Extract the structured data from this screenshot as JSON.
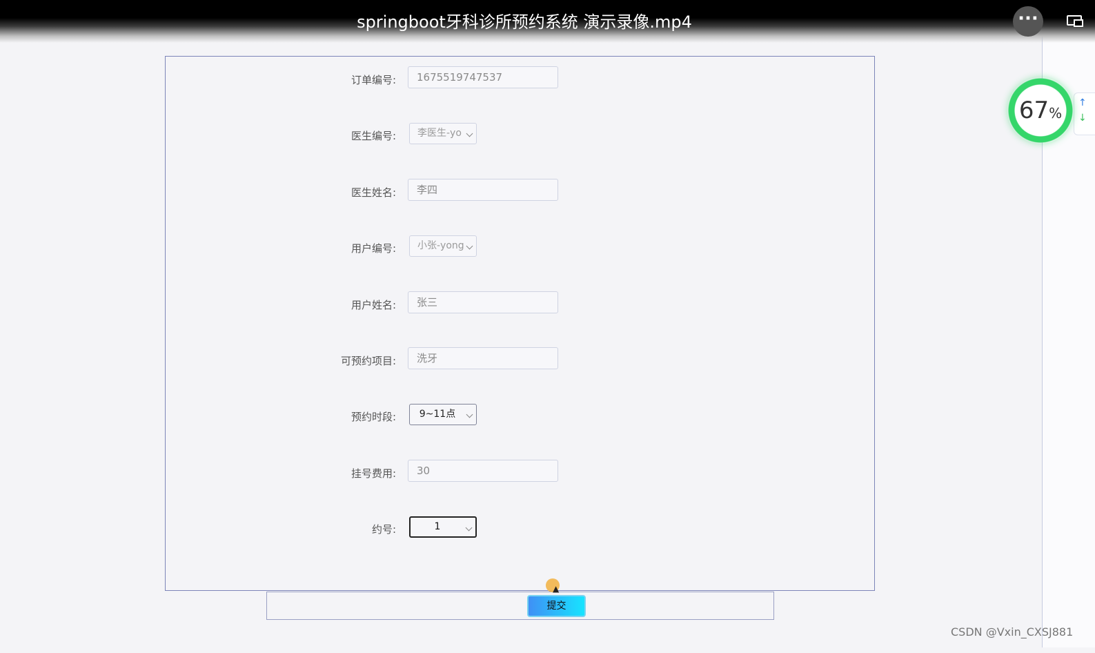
{
  "video": {
    "title": "springboot牙科诊所预约系统 演示录像.mp4",
    "more_label": "···"
  },
  "badge": {
    "value": "67",
    "unit": "%"
  },
  "form": {
    "order_no": {
      "label": "订单编号:",
      "value": "1675519747537"
    },
    "doctor_id": {
      "label": "医生编号:",
      "value": "李医生-yo"
    },
    "doctor_name": {
      "label": "医生姓名:",
      "value": "李四"
    },
    "user_id": {
      "label": "用户编号:",
      "value": "小张-yong"
    },
    "user_name": {
      "label": "用户姓名:",
      "value": "张三"
    },
    "project": {
      "label": "可预约项目:",
      "value": "洗牙"
    },
    "time_slot": {
      "label": "预约时段:",
      "value": "9~11点"
    },
    "fee": {
      "label": "挂号费用:",
      "value": "30"
    },
    "appointment_no": {
      "label": "约号:",
      "value": "1"
    }
  },
  "submit_label": "提交",
  "watermark": "CSDN @Vxin_CXSJ881",
  "icons": {
    "more": "ellipsis-icon",
    "screen": "picture-in-picture-icon",
    "arrow_up": "arrow-up-icon",
    "arrow_down": "arrow-down-icon",
    "chevron": "chevron-down-icon"
  },
  "colors": {
    "submit_start": "#3f90f5",
    "submit_end": "#17e4ff",
    "badge_ring": "#35d66a",
    "panel_border": "#7c84b8"
  }
}
